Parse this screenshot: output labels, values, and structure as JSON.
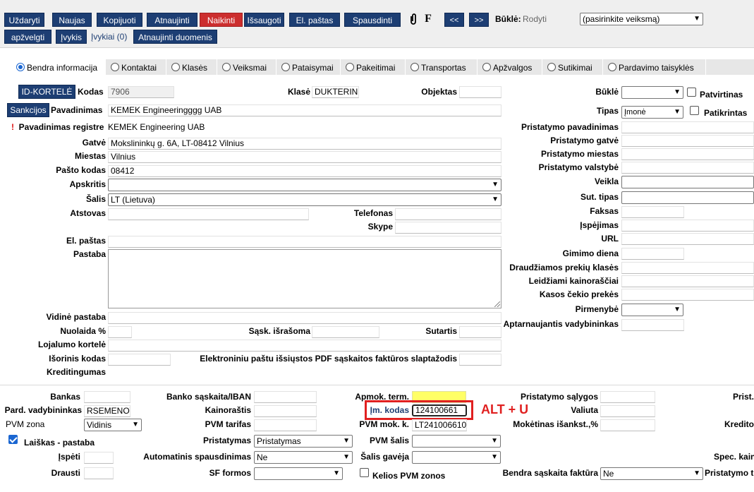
{
  "toolbar": {
    "uzdaryti": "Uždaryti",
    "naujas": "Naujas",
    "kopijuoti": "Kopijuoti",
    "atnaujinti": "Atnaujinti",
    "naikinti": "Naikinti",
    "issaugoti": "Išsaugoti",
    "el_pastas": "El. paštas",
    "spausdinti": "Spausdinti",
    "f_label": "F",
    "prev": "<<",
    "next": ">>",
    "bukle_label": "Būklė:",
    "bukle_value": "Rodyti",
    "action_select": "(pasirinkite veiksmą)",
    "apzvelgti": "apžvelgti",
    "ivykis": "Įvykis",
    "ivykiai_link": "Įvykiai (0)",
    "atnaujinti_duomenis": "Atnaujinti duomenis"
  },
  "tabs": [
    {
      "label": "Bendra informacija",
      "active": true
    },
    {
      "label": "Kontaktai"
    },
    {
      "label": "Klasės"
    },
    {
      "label": "Veiksmai"
    },
    {
      "label": "Pataisymai"
    },
    {
      "label": "Pakeitimai"
    },
    {
      "label": "Transportas"
    },
    {
      "label": "Apžvalgos"
    },
    {
      "label": "Sutikimai"
    },
    {
      "label": "Pardavimo taisyklės"
    }
  ],
  "left": {
    "id_kortele_btn": "ID-KORTELĖ",
    "kodas_label": "Kodas",
    "kodas_value": "7906",
    "klase_label": "Klasė",
    "klase_value": "DUKTERINĖ",
    "objektas_label": "Objektas",
    "sankcijos_btn": "Sankcijos",
    "pavadinimas_label": "Pavadinimas",
    "pavadinimas_value": "KEMEK Engineeringggg UAB",
    "registre_mark": "!",
    "registre_label": "Pavadinimas registre",
    "registre_value": "KEMEK Engineering UAB",
    "gatve_label": "Gatvė",
    "gatve_value": "Mokslininkų g. 6A, LT-08412 Vilnius",
    "miestas_label": "Miestas",
    "miestas_value": "Vilnius",
    "pasto_kodas_label": "Pašto kodas",
    "pasto_kodas_value": "08412",
    "apskritis_label": "Apskritis",
    "apskritis_value": "",
    "salis_label": "Šalis",
    "salis_value": "LT (Lietuva)",
    "atstovas_label": "Atstovas",
    "telefonas_label": "Telefonas",
    "skype_label": "Skype",
    "el_pastas_label": "El. paštas",
    "pastaba_label": "Pastaba",
    "vidine_pastaba_label": "Vidinė pastaba",
    "nuolaida_label": "Nuolaida %",
    "sask_israsoma_label": "Sąsk. išrašoma",
    "sutartis_label": "Sutartis",
    "lojalumo_label": "Lojalumo kortelė",
    "isorinis_kodas_label": "Išorinis kodas",
    "pdf_label": "Elektroniniu paštu išsiųstos PDF sąskaitos faktūros slaptažodis",
    "kreditingumas_label": "Kreditingumas"
  },
  "right": {
    "bukle_label": "Būklė",
    "bukle_value": "",
    "patvirtinas_label": "Patvirtinas",
    "tipas_label": "Tipas",
    "tipas_value": "Įmonė",
    "patikrintas_label": "Patikrintas",
    "pristatymo_pavadinimas_label": "Pristatymo pavadinimas",
    "pristatymo_gatve_label": "Pristatymo gatvė",
    "pristatymo_miestas_label": "Pristatymo miestas",
    "pristatymo_valstybe_label": "Pristatymo valstybė",
    "veikla_label": "Veikla",
    "sut_tipas_label": "Sut. tipas",
    "faksas_label": "Faksas",
    "ispejimas_label": "Įspėjimas",
    "url_label": "URL",
    "gimimo_diena_label": "Gimimo diena",
    "draudziamos_label": "Draudžiamos prekių klasės",
    "leidziami_label": "Leidžiami kainoraščiai",
    "kasos_label": "Kasos čekio prekės",
    "pirmenybe_label": "Pirmenybė",
    "pirmenybe_value": "",
    "aptarnaujantis_label": "Aptarnaujantis vadybininkas"
  },
  "bottom": {
    "bankas_label": "Bankas",
    "banko_saskaita_label": "Banko sąskaita/IBAN",
    "apmok_term_label": "Apmok. term.",
    "pristatymo_salygos_label": "Pristatymo sąlygos",
    "prist_cut_label": "Prist.",
    "pard_vadybininkas_label": "Pard. vadybininkas",
    "pard_vadybininkas_value": "RSEMENOVAS",
    "kainorastis_label": "Kainoraštis",
    "im_kodas_label": "Įm. kodas",
    "im_kodas_value": "124100661",
    "alt_u": "ALT + U",
    "valiuta_label": "Valiuta",
    "pvm_zona_label": "PVM zona",
    "pvm_zona_value": "Vidinis",
    "pvm_tarifas_label": "PVM tarifas",
    "pvm_mok_k_label": "PVM mok. k.",
    "pvm_mok_k_value": "LT241006610",
    "moketinas_label": "Mokėtinas išankst.,%",
    "kredito_cut_label": "Kredito",
    "laiskas_label": "Laiškas - pastaba",
    "pristatymas_label": "Pristatymas",
    "pristatymas_value": "Pristatymas",
    "pvm_salis_label": "PVM šalis",
    "pvm_salis_value": "",
    "ispeti_label": "Įspėti",
    "auto_spausdinimas_label": "Automatinis spausdinimas",
    "auto_spausdinimas_value": "Ne",
    "salis_gaveja_label": "Šalis gavėja",
    "salis_gaveja_value": "",
    "spec_kain_cut_label": "Spec. kain",
    "drausti_label": "Drausti",
    "sf_formos_label": "SF formos",
    "sf_formos_value": "",
    "kelios_pvm_label": "Kelios PVM zonos",
    "bendra_saskaita_label": "Bendra sąskaita faktūra",
    "bendra_saskaita_value": "Ne",
    "pristatymo_t_cut_label": "Pristatymo t"
  },
  "colors": {
    "button_blue": "#1d3e73",
    "button_red": "#cc2e2e",
    "highlight_red": "#e02020",
    "apmok_yellow": "#ffff66"
  }
}
